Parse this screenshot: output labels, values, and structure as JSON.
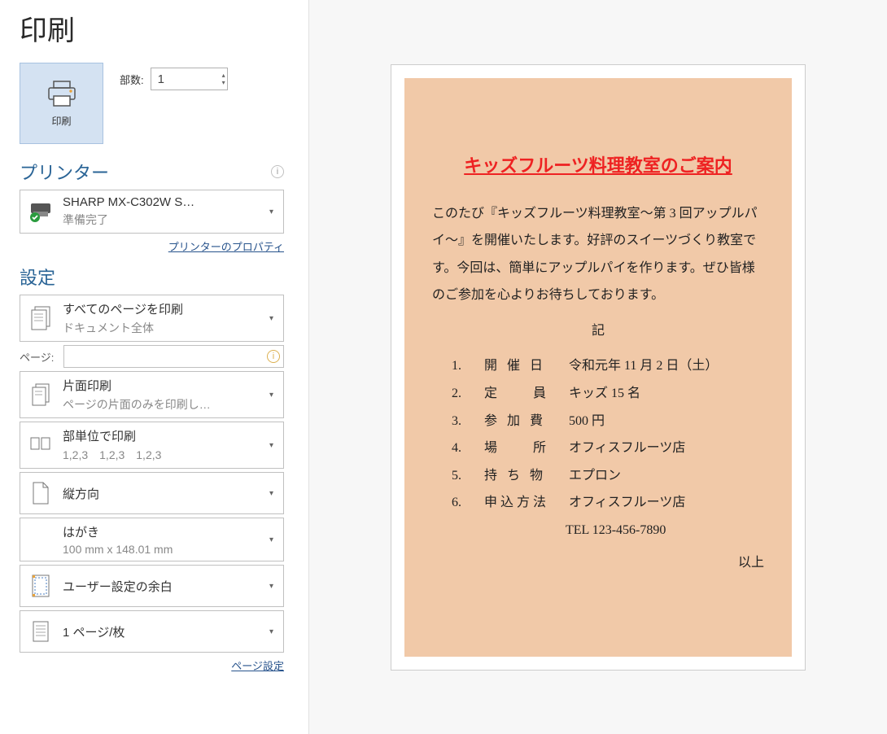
{
  "title": "印刷",
  "printButtonLabel": "印刷",
  "copies": {
    "label": "部数:",
    "value": "1"
  },
  "printer": {
    "heading": "プリンター",
    "name": "SHARP MX-C302W S…",
    "status": "準備完了",
    "propertiesLink": "プリンターのプロパティ"
  },
  "settings": {
    "heading": "設定",
    "pageRange": {
      "line1": "すべてのページを印刷",
      "line2": "ドキュメント全体"
    },
    "pagesLabel": "ページ:",
    "pagesValue": "",
    "duplex": {
      "line1": "片面印刷",
      "line2": "ページの片面のみを印刷し…"
    },
    "collate": {
      "line1": "部単位で印刷",
      "line2": "1,2,3　1,2,3　1,2,3"
    },
    "orientation": {
      "line1": "縦方向"
    },
    "paper": {
      "line1": "はがき",
      "line2": "100 mm x 148.01 mm"
    },
    "margins": {
      "line1": "ユーザー設定の余白"
    },
    "pagesPerSheet": {
      "line1": "1 ページ/枚"
    },
    "pageSetupLink": "ページ設定"
  },
  "preview": {
    "title": "キッズフルーツ料理教室のご案内",
    "body": "このたび『キッズフルーツ料理教室～第 3 回アップルパイ～』を開催いたします。好評のスイーツづくり教室です。今回は、簡単にアップルパイを作ります。ぜひ皆様のご参加を心よりお待ちしております。",
    "ki": "記",
    "items": [
      {
        "n": "1.",
        "label": "開 催 日",
        "value": "令和元年 11 月 2 日（土）"
      },
      {
        "n": "2.",
        "label": "定　　員",
        "value": "キッズ 15 名"
      },
      {
        "n": "3.",
        "label": "参 加 費",
        "value": "500 円"
      },
      {
        "n": "4.",
        "label": "場　　所",
        "value": "オフィスフルーツ店"
      },
      {
        "n": "5.",
        "label": "持 ち 物",
        "value": "エプロン"
      },
      {
        "n": "6.",
        "label": "申込方法",
        "value": "オフィスフルーツ店"
      }
    ],
    "tel": "TEL 123-456-7890",
    "closing": "以上"
  }
}
